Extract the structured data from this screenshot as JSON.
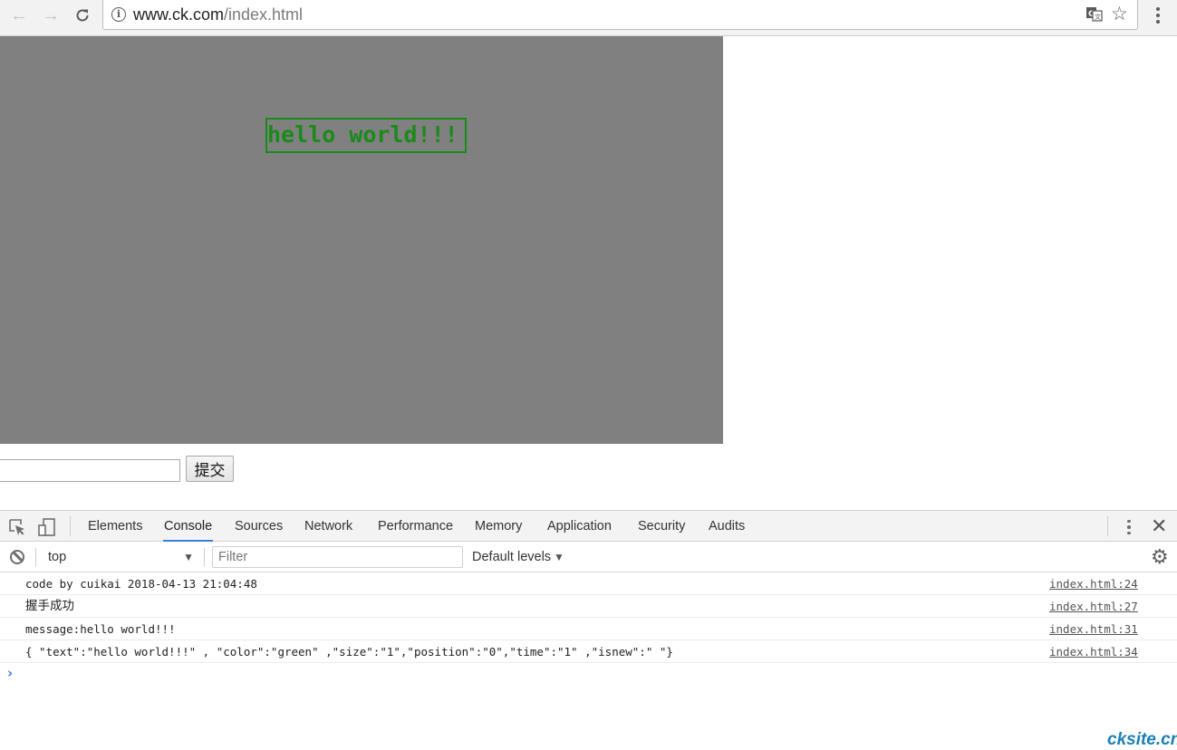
{
  "browser": {
    "url_host": "www.ck.com",
    "url_path": "/index.html",
    "icons": {
      "back": "arrow-left",
      "forward": "arrow-right",
      "reload": "reload",
      "info": "i",
      "translate": "translate",
      "bookmark": "☆",
      "menu": "vertical-dots"
    }
  },
  "page": {
    "danmaku_text": "hello world!!!",
    "danmaku_color": "#1a8a1a",
    "canvas_bg": "#808080",
    "message_input_value": "",
    "submit_label": "提交"
  },
  "devtools": {
    "tabs": [
      {
        "label": "Elements"
      },
      {
        "label": "Console",
        "selected": true
      },
      {
        "label": "Sources"
      },
      {
        "label": "Network"
      },
      {
        "label": "Performance"
      },
      {
        "label": "Memory"
      },
      {
        "label": "Application"
      },
      {
        "label": "Security"
      },
      {
        "label": "Audits"
      }
    ],
    "close_glyph": "✕",
    "context": "top",
    "filter_placeholder": "Filter",
    "levels_label": "Default levels",
    "dropdown_arrow": "▼",
    "gear_glyph": "⚙",
    "prompt_glyph": "›",
    "logs": [
      {
        "message": "code by cuikai 2018-04-13 21:04:48",
        "source": "index.html:24"
      },
      {
        "message": "握手成功",
        "source": "index.html:27"
      },
      {
        "message": "message:hello world!!!",
        "source": "index.html:31"
      },
      {
        "message": "{ \"text\":\"hello world!!!\" , \"color\":\"green\" ,\"size\":\"1\",\"position\":\"0\",\"time\":\"1\" ,\"isnew\":\" \"}",
        "source": "index.html:34"
      }
    ]
  },
  "watermark": "cksite.cn"
}
